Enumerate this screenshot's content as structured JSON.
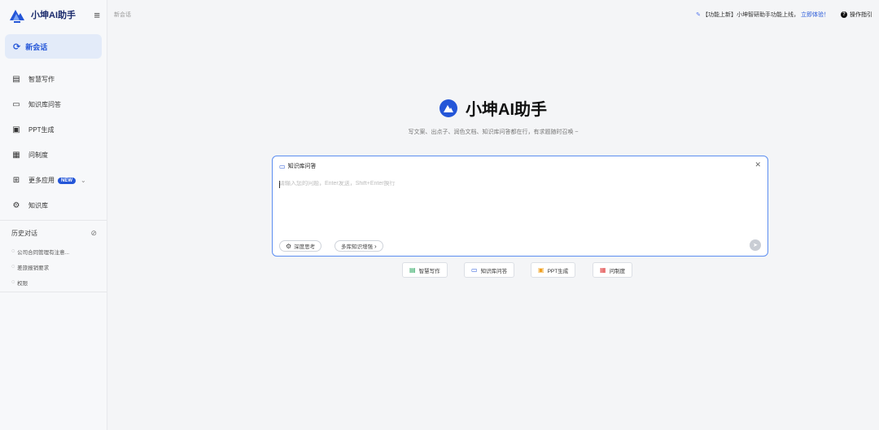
{
  "brand": {
    "name": "小坤AI助手",
    "logo_icon": "mountain-logo-icon"
  },
  "sidebar": {
    "new_chat": "新会话",
    "items": [
      {
        "label": "智慧写作",
        "icon": "document-edit-icon"
      },
      {
        "label": "知识库问答",
        "icon": "book-icon"
      },
      {
        "label": "PPT生成",
        "icon": "ppt-icon"
      },
      {
        "label": "问制度",
        "icon": "clipboard-icon"
      },
      {
        "label": "更多应用",
        "icon": "grid-icon",
        "badge": "NEW"
      },
      {
        "label": "知识库",
        "icon": "gear-icon"
      }
    ],
    "history_title": "历史对话",
    "history": [
      "公司合同管理有注意...",
      "差旅报销要求",
      "权限"
    ]
  },
  "header": {
    "breadcrumb": "新会话",
    "announcement": "【功能上新】小坤智研助手功能上线，",
    "announcement_link": "立即体验！",
    "guide": "操作指引"
  },
  "hero": {
    "title": "小坤AI助手",
    "subtitle": "写文案、出点子、润色文档、知识库问答都在行，有求题随时召唤 ~"
  },
  "composer": {
    "mode_label": "知识库问答",
    "placeholder": "请输入您的问题，Enter发送，Shift+Enter换行",
    "deep_think": "深度思考",
    "multi_kb": "多库知识增强"
  },
  "quick_actions": [
    {
      "label": "智慧写作",
      "color": "#22a35a"
    },
    {
      "label": "知识库问答",
      "color": "#2456d8"
    },
    {
      "label": "PPT生成",
      "color": "#f0a020"
    },
    {
      "label": "问制度",
      "color": "#e04040"
    }
  ],
  "colors": {
    "accent": "#2456d8",
    "composer_border": "#5c8ef0"
  }
}
